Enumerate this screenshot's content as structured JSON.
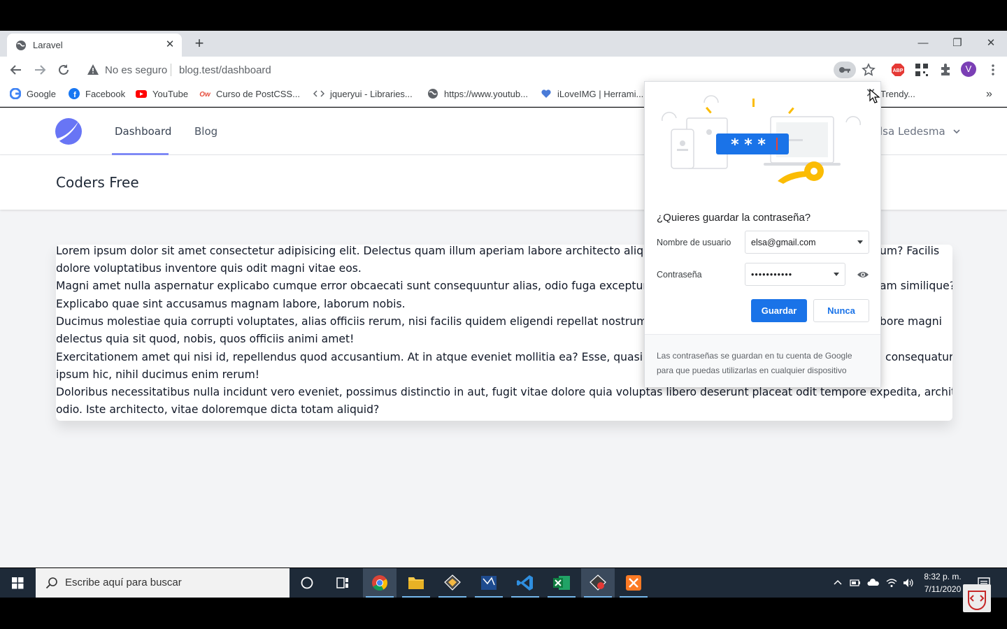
{
  "browser": {
    "tab": {
      "title": "Laravel",
      "close": "✕"
    },
    "new_tab": "+",
    "window": {
      "minimize": "—",
      "restore": "❐",
      "close": "✕"
    },
    "security_label": "No es seguro",
    "url": "blog.test/dashboard",
    "profile_initial": "V",
    "bookmarks": [
      {
        "label": "Google",
        "icon": "google-icon"
      },
      {
        "label": "Facebook",
        "icon": "facebook-icon"
      },
      {
        "label": "YouTube",
        "icon": "youtube-icon"
      },
      {
        "label": "Curso de PostCSS...",
        "icon": "ow-icon"
      },
      {
        "label": "jqueryui - Libraries...",
        "icon": "code-icon"
      },
      {
        "label": "https://www.youtub...",
        "icon": "globe-icon"
      },
      {
        "label": "iLoveIMG | Herrami...",
        "icon": "heart-icon"
      },
      {
        "label": "Trendy...",
        "icon": "bookmark-icon"
      }
    ],
    "bookmarks_more": "»"
  },
  "page": {
    "nav": {
      "links": [
        "Dashboard",
        "Blog"
      ],
      "active": "Dashboard",
      "user": "lsa Ledesma"
    },
    "header_title": "Coders Free",
    "paragraphs": [
      [
        "Lorem ipsum dolor sit amet consectetur adipisicing elit. Delectus quam illum aperiam labore architecto aliquid vo",
        "um? Facilis"
      ],
      [
        "dolore voluptatibus inventore quis odit magni vitae eos.",
        ""
      ],
      [
        "Magni amet nulla aspernatur explicabo cumque error obcaecati sunt consequuntur alias, odio fuga excepturi labo",
        "am similique?"
      ],
      [
        "Explicabo quae sint accusamus magnam labore, laborum nobis.",
        ""
      ],
      [
        "Ducimus molestiae quia corrupti voluptates, alias officiis rerum, nisi facilis quidem eligendi repellat nostrum magr",
        "bore magni"
      ],
      [
        "delectus quia sit quod, nobis, quos officiis animi amet!",
        ""
      ],
      [
        "Exercitationem amet qui nisi id, repellendus quod accusantium. At in atque eveniet mollitia ea? Esse, quasi vel an",
        "consequatur"
      ],
      [
        "ipsum hic, nihil ducimus enim rerum!",
        ""
      ],
      [
        "Doloribus necessitatibus nulla incidunt vero eveniet, possimus distinctio in aut, fugit vitae dolore quia voluptas libero deserunt placeat odit tempore expedita, architecto",
        ""
      ],
      [
        "odio. Iste architecto, vitae doloremque dicta totam aliquid?",
        ""
      ]
    ]
  },
  "password_popup": {
    "question": "¿Quieres guardar la contraseña?",
    "username_label": "Nombre de usuario",
    "username_value": "elsa@gmail.com",
    "password_label": "Contraseña",
    "password_value": "•••••••••••",
    "save_label": "Guardar",
    "never_label": "Nunca",
    "footer": "Las contraseñas se guardan en tu cuenta de Google para que puedas utilizarlas en cualquier dispositivo",
    "illustration_text": "* * *",
    "close": "✕"
  },
  "taskbar": {
    "search_placeholder": "Escribe aquí para buscar",
    "time": "8:32 p. m.",
    "date": "7/11/2020"
  },
  "colors": {
    "accent_blue": "#1a73e8",
    "nav_underline": "#818cf8",
    "taskbar": "#1e2a38"
  }
}
